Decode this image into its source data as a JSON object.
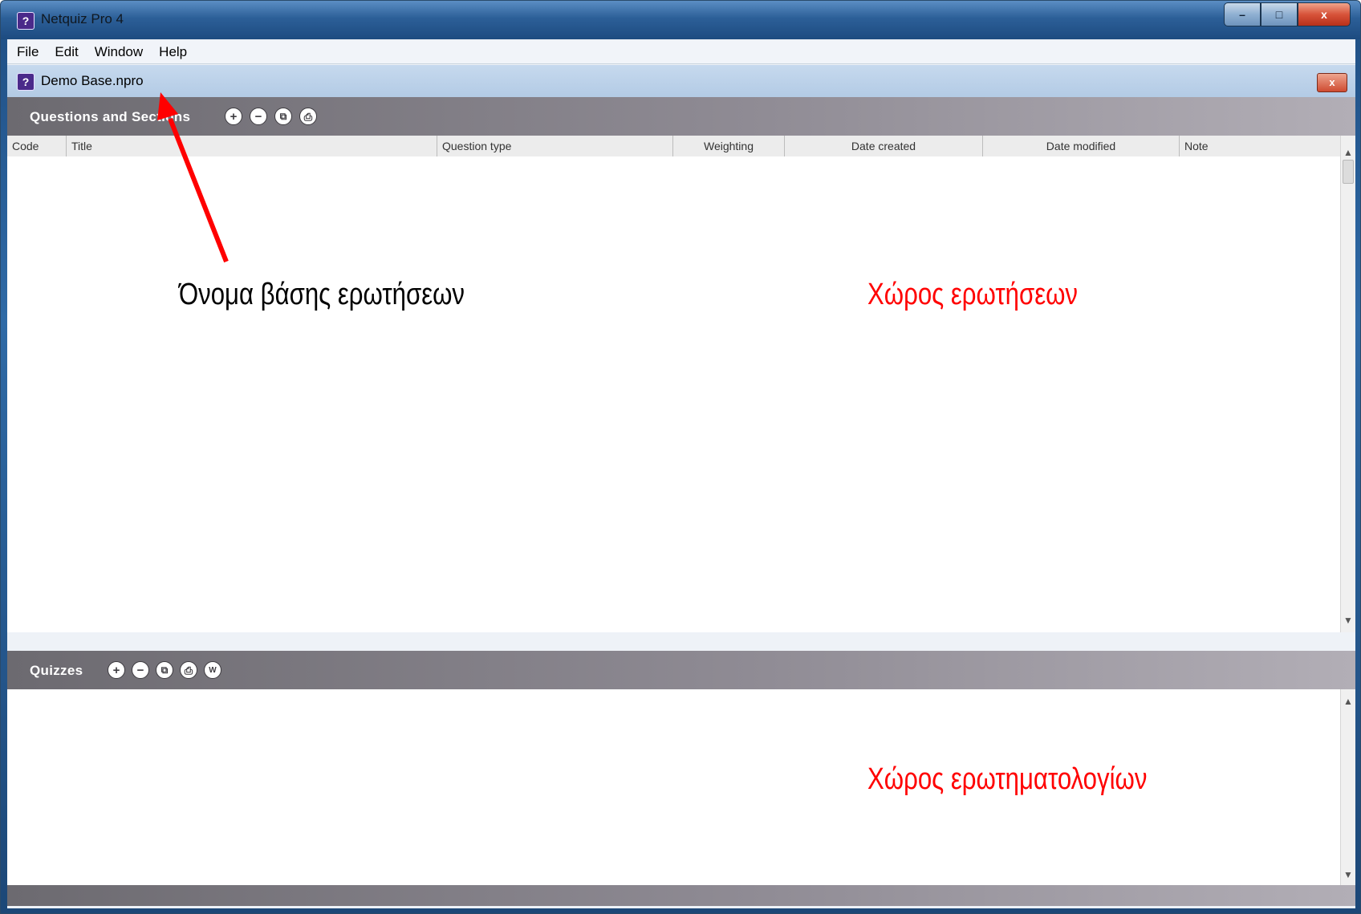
{
  "window": {
    "title": "Netquiz Pro 4",
    "app_icon_glyph": "?",
    "controls": {
      "minimize": "–",
      "maximize": "□",
      "close": "x"
    }
  },
  "menubar": {
    "items": [
      "File",
      "Edit",
      "Window",
      "Help"
    ]
  },
  "document": {
    "title": "Demo Base.npro",
    "icon_glyph": "?",
    "close_glyph": "x"
  },
  "questions_panel": {
    "label": "Questions and Sections",
    "toolbar_icons": [
      "add-icon",
      "remove-icon",
      "duplicate-icon",
      "print-icon"
    ],
    "toolbar_glyphs": [
      "+",
      "−",
      "⧉",
      "⎙"
    ],
    "columns": [
      "Code",
      "Title",
      "Question type",
      "Weighting",
      "Date created",
      "Date modified",
      "Note"
    ],
    "rows": []
  },
  "quizzes_panel": {
    "label": "Quizzes",
    "toolbar_icons": [
      "add-icon",
      "remove-icon",
      "duplicate-icon",
      "print-icon",
      "word-export-icon"
    ],
    "toolbar_glyphs": [
      "+",
      "−",
      "⧉",
      "⎙",
      "W"
    ],
    "rows": []
  },
  "annotations": {
    "db_name": "Όνομα βάσης ερωτήσεων",
    "questions_area": "Χώρος ερωτήσεων",
    "quizzes_area": "Χώρος ερωτηματολογίων"
  },
  "colors": {
    "annotation_red": "#ff0000",
    "arrow_red": "#ff0000",
    "panel_gray": "#8f8b94"
  }
}
